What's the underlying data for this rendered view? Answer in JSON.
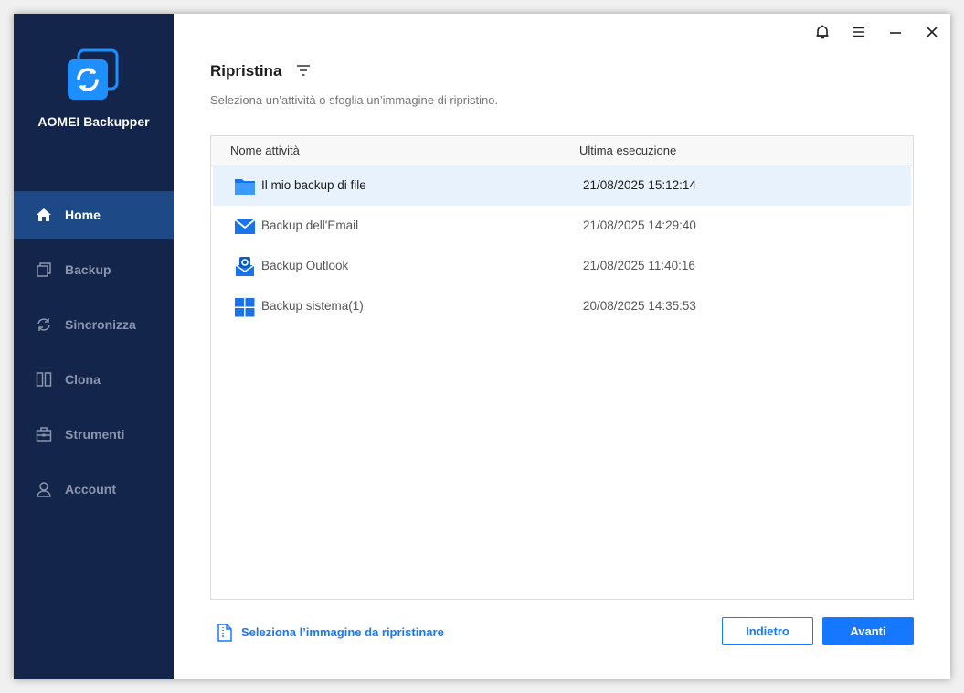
{
  "app": {
    "name": "AOMEI Backupper"
  },
  "sidebar": {
    "items": [
      {
        "label": "Home",
        "icon": "home-icon",
        "active": true
      },
      {
        "label": "Backup",
        "icon": "backup-icon",
        "active": false
      },
      {
        "label": "Sincronizza",
        "icon": "sync-icon",
        "active": false
      },
      {
        "label": "Clona",
        "icon": "clone-icon",
        "active": false
      },
      {
        "label": "Strumenti",
        "icon": "tools-icon",
        "active": false
      },
      {
        "label": "Account",
        "icon": "account-icon",
        "active": false
      }
    ]
  },
  "window_controls": [
    "bell-icon",
    "menu-icon",
    "minimize-icon",
    "close-icon"
  ],
  "page": {
    "title": "Ripristina",
    "subtitle": "Seleziona un’attività o sfoglia un’immagine di ripristino."
  },
  "table": {
    "columns": [
      "Nome attività",
      "Ultima esecuzione"
    ],
    "rows": [
      {
        "name": "Il mio backup di file",
        "last_run": "21/08/2025 15:12:14",
        "icon": "folder-icon",
        "selected": true
      },
      {
        "name": "Backup dell'Email",
        "last_run": "21/08/2025 14:29:40",
        "icon": "email-icon",
        "selected": false
      },
      {
        "name": "Backup Outlook",
        "last_run": "21/08/2025 11:40:16",
        "icon": "outlook-icon",
        "selected": false
      },
      {
        "name": "Backup sistema(1)",
        "last_run": "20/08/2025 14:35:53",
        "icon": "windows-icon",
        "selected": false
      }
    ]
  },
  "footer": {
    "select_image_label": "Seleziona l’immagine da ripristinare",
    "back_label": "Indietro",
    "next_label": "Avanti"
  },
  "colors": {
    "sidebar_bg": "#13254a",
    "sidebar_active": "#1d4a87",
    "accent": "#1677ff",
    "selected_row": "#e8f2fd"
  }
}
